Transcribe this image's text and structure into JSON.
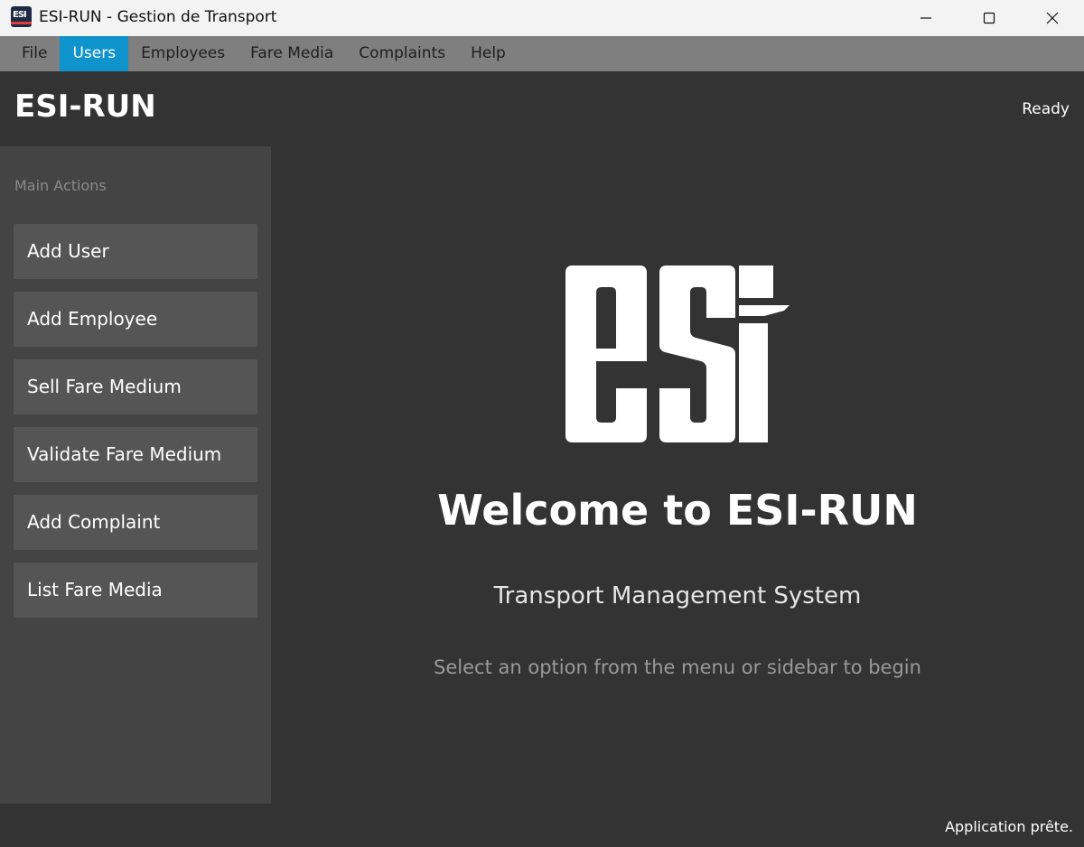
{
  "window": {
    "title": "ESI-RUN - Gestion de Transport",
    "app_icon": "esi-app-icon",
    "controls": [
      "minimize-icon",
      "maximize-icon",
      "close-icon"
    ]
  },
  "menu": {
    "items": [
      {
        "label": "File",
        "active": false
      },
      {
        "label": "Users",
        "active": true
      },
      {
        "label": "Employees",
        "active": false
      },
      {
        "label": "Fare Media",
        "active": false
      },
      {
        "label": "Complaints",
        "active": false
      },
      {
        "label": "Help",
        "active": false
      }
    ]
  },
  "header": {
    "brand": "ESI-RUN",
    "status": "Ready"
  },
  "sidebar": {
    "title": "Main Actions",
    "buttons": [
      {
        "label": "Add User"
      },
      {
        "label": "Add Employee"
      },
      {
        "label": "Sell Fare Medium"
      },
      {
        "label": "Validate Fare Medium"
      },
      {
        "label": "Add Complaint"
      },
      {
        "label": "List Fare Media"
      }
    ]
  },
  "main": {
    "logo_icon": "esi-logo",
    "welcome": "Welcome to ESI-RUN",
    "subtitle": "Transport Management System",
    "hint": "Select an option from the menu or sidebar to begin"
  },
  "statusbar": {
    "text": "Application prête."
  },
  "colors": {
    "menu_active": "#0f93cd",
    "background": "#333333",
    "sidebar": "#444444",
    "button": "#555555"
  }
}
